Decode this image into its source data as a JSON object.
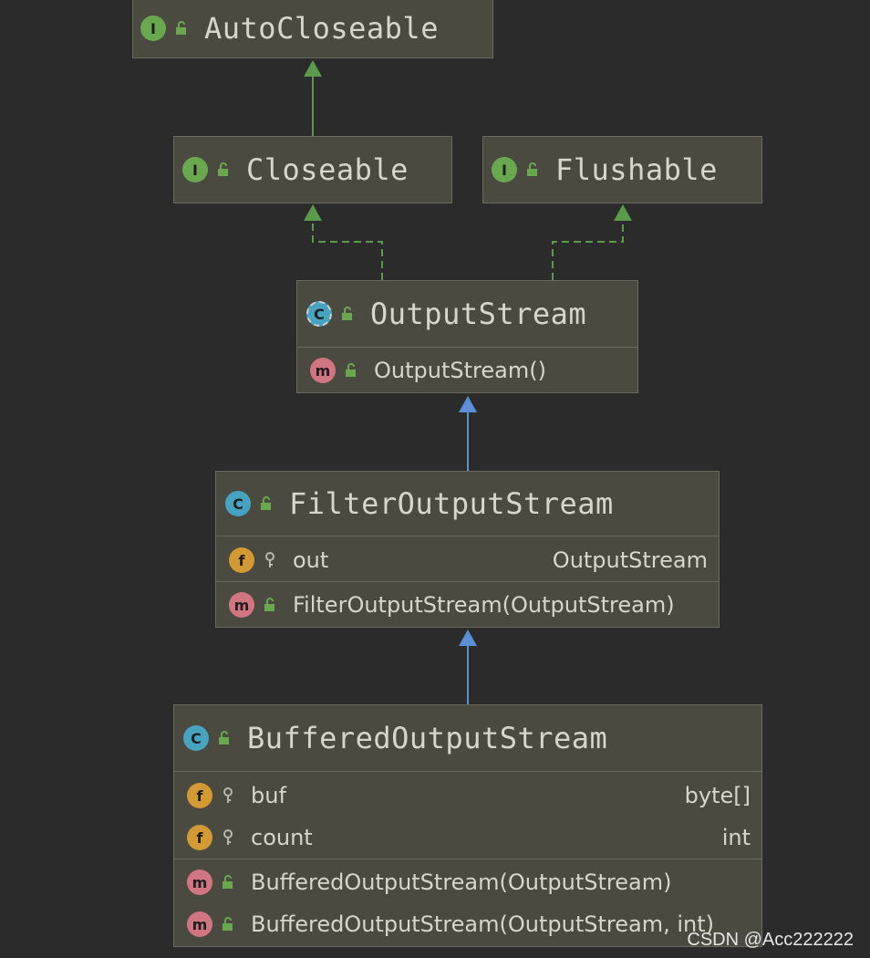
{
  "classes": {
    "autocloseable": {
      "kind": "I",
      "name": "AutoCloseable"
    },
    "closeable": {
      "kind": "I",
      "name": "Closeable"
    },
    "flushable": {
      "kind": "I",
      "name": "Flushable"
    },
    "outputstream": {
      "kind": "C",
      "name": "OutputStream",
      "methods": [
        "OutputStream()"
      ]
    },
    "filteroutputstream": {
      "kind": "C",
      "name": "FilterOutputStream",
      "fields": [
        {
          "name": "out",
          "type": "OutputStream"
        }
      ],
      "methods": [
        "FilterOutputStream(OutputStream)"
      ]
    },
    "bufferedoutputstream": {
      "kind": "C",
      "name": "BufferedOutputStream",
      "fields": [
        {
          "name": "buf",
          "type": "byte[]"
        },
        {
          "name": "count",
          "type": "int"
        }
      ],
      "methods": [
        "BufferedOutputStream(OutputStream)",
        "BufferedOutputStream(OutputStream, int)"
      ]
    }
  },
  "badges": {
    "field": "f",
    "method": "m",
    "class": "C",
    "interface": "I"
  },
  "colors": {
    "background": "#2b2b2b",
    "box": "#4b4a40",
    "extends_arrow": "#5b8fd6",
    "implements_arrow": "#5a9a4a",
    "interface_badge": "#6aa84f",
    "class_badge": "#46a4c0",
    "method_badge": "#d27582",
    "field_badge": "#d39a34"
  },
  "icons": {
    "public": "open-lock-icon",
    "private": "key-icon"
  },
  "watermark": "CSDN @Acc222222"
}
